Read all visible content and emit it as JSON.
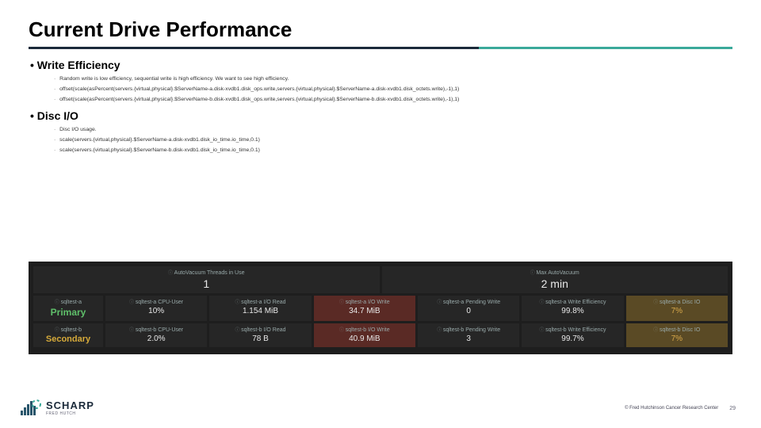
{
  "title": "Current Drive Performance",
  "write": {
    "heading": "Write Efficiency",
    "desc": "Random write is low efficiency, sequential write is high efficiency. We want to see high efficiency.",
    "code1": "offset(scale(asPercent(servers.{virtual,physical}.$ServerName-a.disk-xvdb1.disk_ops.write,servers.{virtual,physical}.$ServerName-a.disk-xvdb1.disk_octets.write),-1),1)",
    "code2": "offset(scale(asPercent(servers.{virtual,physical}.$ServerName-b.disk-xvdb1.disk_ops.write,servers.{virtual,physical}.$ServerName-b.disk-xvdb1.disk_octets.write),-1),1)"
  },
  "disc": {
    "heading": "Disc I/O",
    "desc": "Disc I/O usage.",
    "code1": "scale(servers.{virtual,physical}.$ServerName-a.disk-xvdb1.disk_io_time.io_time,0.1)",
    "code2": "scale(servers.{virtual,physical}.$ServerName-b.disk-xvdb1.disk_io_time.io_time,0.1)"
  },
  "dash": {
    "threads": {
      "h": "AutoVacuum Threads in Use",
      "v": "1"
    },
    "maxav": {
      "h": "Max AutoVacuum",
      "v": "2 min"
    },
    "rowA": {
      "name": {
        "h": "sqltest-a",
        "v": "Primary"
      },
      "cpu": {
        "h": "sqltest-a CPU-User",
        "v": "10%"
      },
      "rd": {
        "h": "sqltest-a I/O Read",
        "v": "1.154 MiB"
      },
      "wr": {
        "h": "sqltest-a I/O Write",
        "v": "34.7 MiB"
      },
      "pw": {
        "h": "sqltest-a Pending Write",
        "v": "0"
      },
      "we": {
        "h": "sqltest-a Write Efficiency",
        "v": "99.8%"
      },
      "io": {
        "h": "sqltest-a Disc IO",
        "v": "7%"
      }
    },
    "rowB": {
      "name": {
        "h": "sqltest-b",
        "v": "Secondary"
      },
      "cpu": {
        "h": "sqltest-b CPU-User",
        "v": "2.0%"
      },
      "rd": {
        "h": "sqltest-b I/O Read",
        "v": "78 B"
      },
      "wr": {
        "h": "sqltest-b I/O Write",
        "v": "40.9 MiB"
      },
      "pw": {
        "h": "sqltest-b Pending Write",
        "v": "3"
      },
      "we": {
        "h": "sqltest-b Write Efficiency",
        "v": "99.7%"
      },
      "io": {
        "h": "sqltest-b Disc IO",
        "v": "7%"
      }
    }
  },
  "footer": {
    "brand": "SCHARP",
    "brand_sub": "FRED HUTCH",
    "copyright": "© Fred Hutchinson Cancer Research Center",
    "page": "29"
  }
}
